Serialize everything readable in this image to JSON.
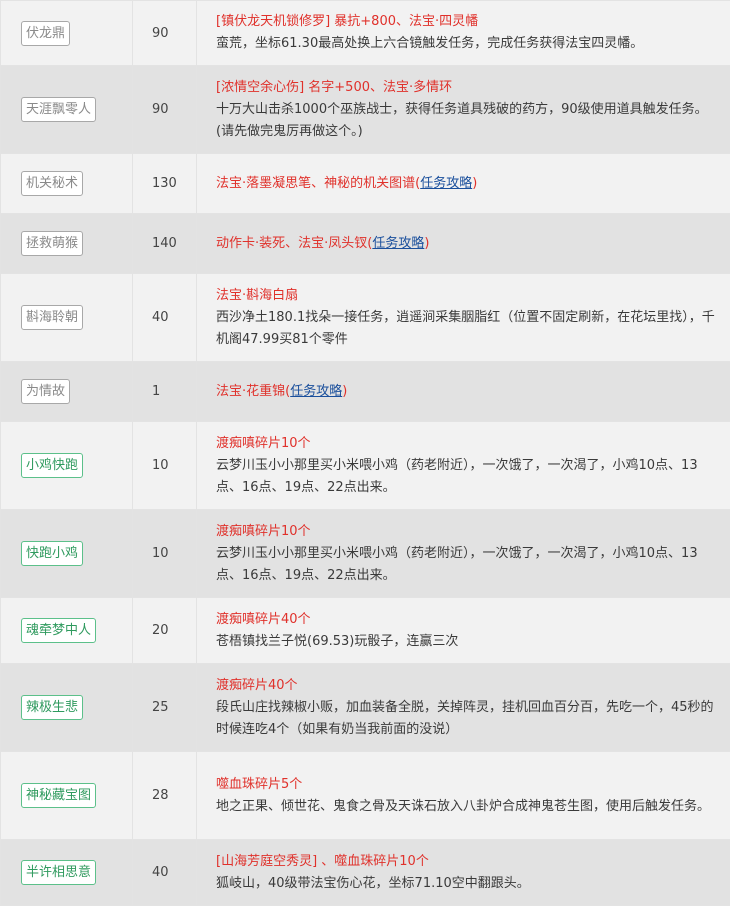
{
  "rows": [
    {
      "name": "伏龙鼎",
      "level": "90",
      "reward": "[镇伏龙天机锁修罗] 暴抗+800、法宝·四灵幡",
      "link": "",
      "link_suffix": "",
      "desc": "蛮荒，坐标61.30最高处换上六合镜触发任务，完成任务获得法宝四灵幡。"
    },
    {
      "name": "天涯飘零人",
      "level": "90",
      "reward": "[浓情空余心伤] 名字+500、法宝·多情环",
      "link": "",
      "link_suffix": "",
      "desc": "十万大山击杀1000个巫族战士，获得任务道具残破的药方，90级使用道具触发任务。(请先做完鬼厉再做这个。)"
    },
    {
      "name": "机关秘术",
      "level": "130",
      "reward": "法宝·落墨凝思笔、神秘的机关图谱(",
      "link": "任务攻略",
      "link_suffix": ")",
      "desc": ""
    },
    {
      "name": "拯救萌猴",
      "level": "140",
      "reward": "动作卡·装死、法宝·凤头钗(",
      "link": "任务攻略",
      "link_suffix": ")",
      "desc": ""
    },
    {
      "name": "斟海聆朝",
      "level": "40",
      "reward": "法宝·斟海白扇",
      "link": "",
      "link_suffix": "",
      "desc": "西沙净土180.1找朵一接任务，逍遥涧采集胭脂红（位置不固定刷新，在花坛里找），千机阁47.99买81个零件"
    },
    {
      "name": "为情故",
      "level": "1",
      "reward": "法宝·花重锦(",
      "link": "任务攻略",
      "link_suffix": ")",
      "desc": ""
    },
    {
      "name": "小鸡快跑",
      "level": "10",
      "reward": "渡痴嗔碎片10个",
      "link": "",
      "link_suffix": "",
      "desc": "云梦川玉小小那里买小米喂小鸡（药老附近），一次饿了，一次渴了，小鸡10点、13点、16点、19点、22点出来。"
    },
    {
      "name": "快跑小鸡",
      "level": "10",
      "reward": "渡痴嗔碎片10个",
      "link": "",
      "link_suffix": "",
      "desc": "云梦川玉小小那里买小米喂小鸡（药老附近），一次饿了，一次渴了，小鸡10点、13点、16点、19点、22点出来。"
    },
    {
      "name": "魂牵梦中人",
      "level": "20",
      "reward": "渡痴嗔碎片40个",
      "link": "",
      "link_suffix": "",
      "desc": "苍梧镇找兰子悦(69.53)玩骰子，连赢三次"
    },
    {
      "name": "辣极生悲",
      "level": "25",
      "reward": "渡痴碎片40个",
      "link": "",
      "link_suffix": "",
      "desc": "段氏山庄找辣椒小贩，加血装备全脱，关掉阵灵，挂机回血百分百，先吃一个，45秒的时候连吃4个（如果有奶当我前面的没说）"
    },
    {
      "name": "神秘藏宝图",
      "level": "28",
      "reward": "噬血珠碎片5个",
      "link": "",
      "link_suffix": "",
      "desc": "地之正果、倾世花、鬼食之骨及天诛石放入八卦炉合成神鬼苍生图，使用后触发任务。"
    },
    {
      "name": "半许相思意",
      "level": "40",
      "reward": "[山海芳庭空秀灵] 、噬血珠碎片10个",
      "link": "",
      "link_suffix": "",
      "desc": "狐岐山，40级带法宝伤心花，坐标71.10空中翻跟头。"
    }
  ]
}
